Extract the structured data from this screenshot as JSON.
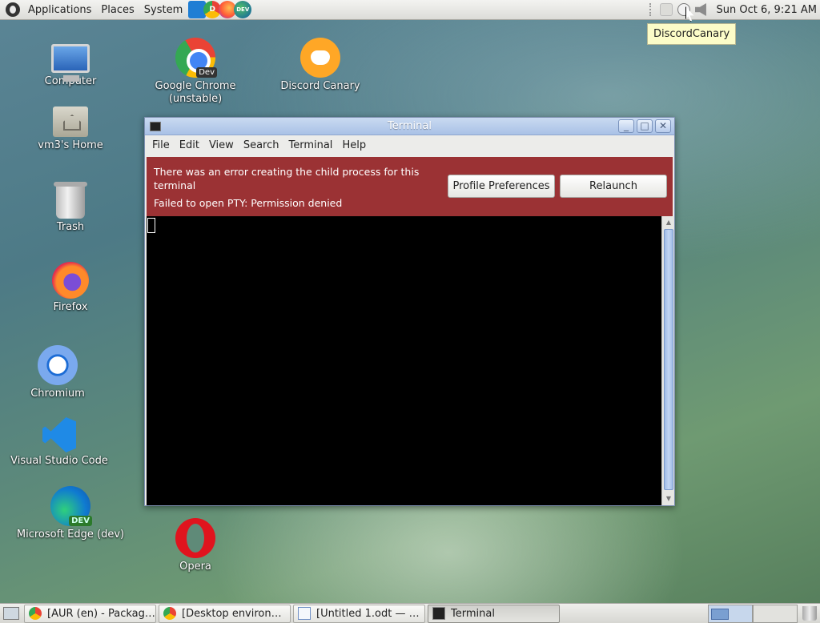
{
  "top_panel": {
    "menus": [
      "Applications",
      "Places",
      "System"
    ],
    "launchers": [
      {
        "icon": "vscode-icon",
        "label": ""
      },
      {
        "icon": "chrome-dev-icon",
        "label": "D"
      },
      {
        "icon": "firefox-icon",
        "label": ""
      },
      {
        "icon": "edge-dev-icon",
        "label": "DEV"
      }
    ],
    "clock": "Sun Oct  6,  9:21 AM",
    "tooltip": "DiscordCanary"
  },
  "desktop_icons": {
    "computer": "Computer",
    "home": "vm3's Home",
    "trash": "Trash",
    "firefox": "Firefox",
    "chromium": "Chromium",
    "vscode": "Visual Studio Code",
    "edge": "Microsoft Edge (dev)",
    "chrome_line1": "Google Chrome",
    "chrome_line2": "(unstable)",
    "chrome_badge": "Dev",
    "edge_badge": "DEV",
    "discord": "Discord Canary",
    "opera": "Opera"
  },
  "terminal_window": {
    "title": "Terminal",
    "menu": [
      "File",
      "Edit",
      "View",
      "Search",
      "Terminal",
      "Help"
    ],
    "error_message": "There was an error creating the child process for this terminal",
    "error_detail": "Failed to open PTY: Permission denied",
    "profile_button": "Profile Preferences",
    "relaunch_button": "Relaunch",
    "window_buttons": {
      "minimize": "_",
      "maximize": "□",
      "close": "✕"
    }
  },
  "taskbar": {
    "tasks": [
      {
        "label": "[AUR (en) - Package...",
        "icon": "chrome-icon",
        "active": false
      },
      {
        "label": "[Desktop environm...",
        "icon": "chrome-icon",
        "active": false
      },
      {
        "label": "[Untitled 1.odt — Li...",
        "icon": "document-icon",
        "active": false
      },
      {
        "label": "Terminal",
        "icon": "terminal-icon",
        "active": true
      }
    ]
  },
  "colors": {
    "error_bar": "#9b3234",
    "titlebar": "#a9c1e6",
    "terminal_bg": "#000000"
  }
}
